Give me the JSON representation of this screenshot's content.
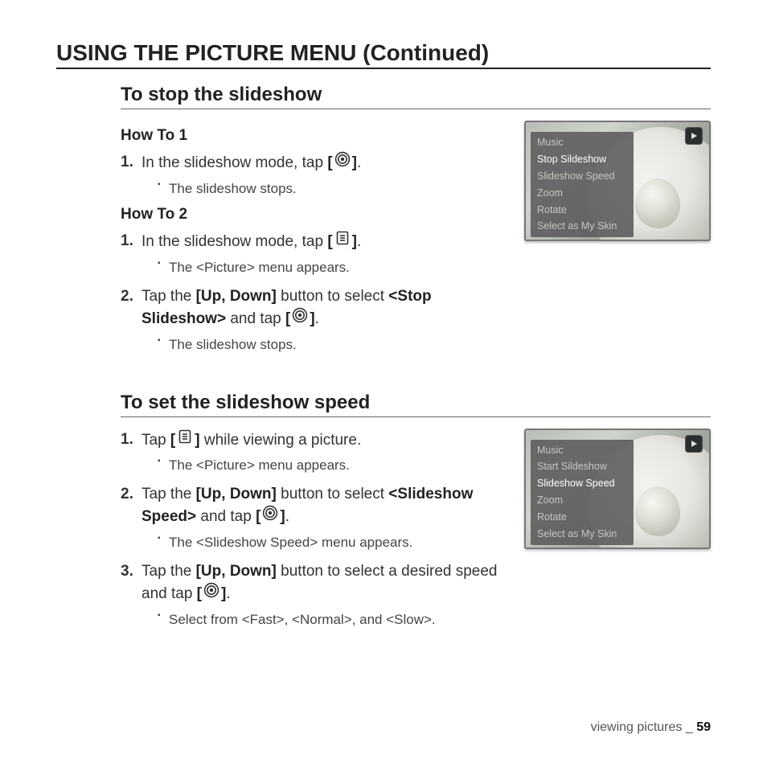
{
  "heading": "USING THE PICTURE MENU (Continued)",
  "sections": [
    {
      "title": "To stop the slideshow",
      "blocks": [
        {
          "label": "How To 1",
          "steps": [
            {
              "num": "1.",
              "html": "In the slideshow mode, tap <b>[</b>{CIRCLE}<b>]</b>.",
              "sub": [
                "The slideshow stops."
              ]
            }
          ]
        },
        {
          "label": "How To 2",
          "steps": [
            {
              "num": "1.",
              "html": "In the slideshow mode, tap <b>[</b>{MENU}<b>]</b>.",
              "sub": [
                "The <Picture> menu appears."
              ]
            },
            {
              "num": "2.",
              "html": "Tap the <b>[Up, Down]</b> button to select <b>&lt;Stop Slideshow&gt;</b> and tap <b>[</b>{CIRCLE}<b>]</b>.",
              "sub": [
                "The slideshow stops."
              ]
            }
          ]
        }
      ],
      "thumb_menu": {
        "items": [
          "Music",
          "Stop Sildeshow",
          "Slideshow Speed",
          "Zoom",
          "Rotate",
          "Select as My Skin"
        ],
        "selected": 1
      }
    },
    {
      "title": "To set the slideshow speed",
      "blocks": [
        {
          "label": "",
          "steps": [
            {
              "num": "1.",
              "html": "Tap <b>[</b>{MENU}<b>]</b> while viewing a picture.",
              "sub": [
                "The <Picture> menu appears."
              ]
            },
            {
              "num": "2.",
              "html": "Tap the <b>[Up, Down]</b> button to select <b>&lt;Slideshow Speed&gt;</b> and tap <b>[</b>{CIRCLE}<b>]</b>.",
              "sub": [
                "The <Slideshow Speed> menu appears."
              ]
            },
            {
              "num": "3.",
              "html": "Tap the <b>[Up, Down]</b> button to select a desired speed and tap <b>[</b>{CIRCLE}<b>]</b>.",
              "sub": [
                "Select from <Fast>, <Normal>, and <Slow>."
              ]
            }
          ]
        }
      ],
      "thumb_menu": {
        "items": [
          "Music",
          "Start Sildeshow",
          "Slideshow Speed",
          "Zoom",
          "Rotate",
          "Select as My Skin"
        ],
        "selected": 2
      }
    }
  ],
  "footer": {
    "label": "viewing pictures _ ",
    "page": "59"
  }
}
